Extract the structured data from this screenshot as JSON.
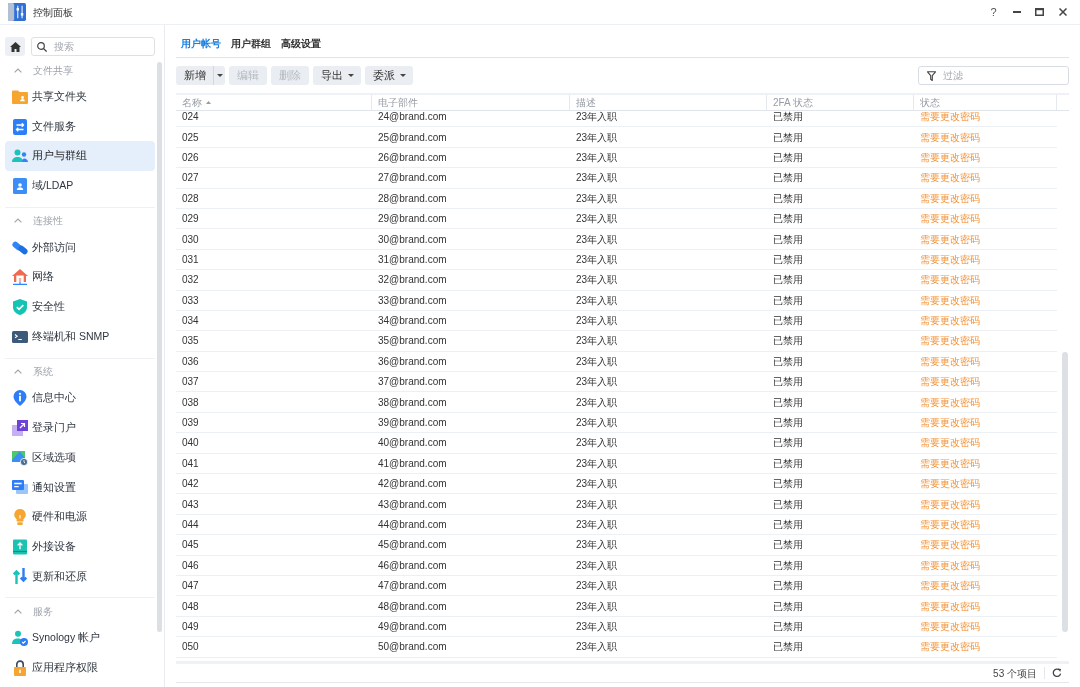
{
  "window": {
    "title": "控制面板",
    "help": "?"
  },
  "sidebar": {
    "search": {
      "placeholder": "搜索"
    },
    "sections": [
      {
        "title": "文件共享",
        "expanded": true,
        "items": [
          {
            "label": "共享文件夹",
            "selected": false
          },
          {
            "label": "文件服务",
            "selected": false
          },
          {
            "label": "用户与群组",
            "selected": true
          },
          {
            "label": "域/LDAP",
            "selected": false
          }
        ]
      },
      {
        "title": "连接性",
        "expanded": true,
        "items": [
          {
            "label": "外部访问",
            "selected": false
          },
          {
            "label": "网络",
            "selected": false
          },
          {
            "label": "安全性",
            "selected": false
          },
          {
            "label": "终端机和 SNMP",
            "selected": false
          }
        ]
      },
      {
        "title": "系统",
        "expanded": true,
        "items": [
          {
            "label": "信息中心",
            "selected": false
          },
          {
            "label": "登录门户",
            "selected": false
          },
          {
            "label": "区域选项",
            "selected": false
          },
          {
            "label": "通知设置",
            "selected": false
          },
          {
            "label": "硬件和电源",
            "selected": false
          },
          {
            "label": "外接设备",
            "selected": false
          },
          {
            "label": "更新和还原",
            "selected": false
          }
        ]
      },
      {
        "title": "服务",
        "expanded": true,
        "items": [
          {
            "label": "Synology 帐户",
            "selected": false
          },
          {
            "label": "应用程序权限",
            "selected": false
          }
        ]
      }
    ]
  },
  "tabs": [
    {
      "label": "用户帐号",
      "selected": true
    },
    {
      "label": "用户群组",
      "selected": false
    },
    {
      "label": "高级设置",
      "selected": false
    }
  ],
  "toolbar": {
    "buttons": [
      {
        "label": "新增",
        "kind": "split",
        "disabled": false
      },
      {
        "label": "编辑",
        "kind": "plain",
        "disabled": true
      },
      {
        "label": "删除",
        "kind": "plain",
        "disabled": true
      },
      {
        "label": "导出",
        "kind": "menu",
        "disabled": false
      },
      {
        "label": "委派",
        "kind": "menu",
        "disabled": false
      }
    ],
    "filter": {
      "placeholder": "过滤"
    }
  },
  "table": {
    "columns": [
      {
        "label": "名称",
        "sorted": true
      },
      {
        "label": "电子部件",
        "sorted": false
      },
      {
        "label": "描述",
        "sorted": false
      },
      {
        "label": "2FA 状态",
        "sorted": false
      },
      {
        "label": "状态",
        "sorted": false
      }
    ],
    "rows": [
      {
        "name": "024",
        "email": "24@brand.com",
        "description": "23年入职",
        "twofa": "已禁用",
        "status": "需要更改密码"
      },
      {
        "name": "025",
        "email": "25@brand.com",
        "description": "23年入职",
        "twofa": "已禁用",
        "status": "需要更改密码"
      },
      {
        "name": "026",
        "email": "26@brand.com",
        "description": "23年入职",
        "twofa": "已禁用",
        "status": "需要更改密码"
      },
      {
        "name": "027",
        "email": "27@brand.com",
        "description": "23年入职",
        "twofa": "已禁用",
        "status": "需要更改密码"
      },
      {
        "name": "028",
        "email": "28@brand.com",
        "description": "23年入职",
        "twofa": "已禁用",
        "status": "需要更改密码"
      },
      {
        "name": "029",
        "email": "29@brand.com",
        "description": "23年入职",
        "twofa": "已禁用",
        "status": "需要更改密码"
      },
      {
        "name": "030",
        "email": "30@brand.com",
        "description": "23年入职",
        "twofa": "已禁用",
        "status": "需要更改密码"
      },
      {
        "name": "031",
        "email": "31@brand.com",
        "description": "23年入职",
        "twofa": "已禁用",
        "status": "需要更改密码"
      },
      {
        "name": "032",
        "email": "32@brand.com",
        "description": "23年入职",
        "twofa": "已禁用",
        "status": "需要更改密码"
      },
      {
        "name": "033",
        "email": "33@brand.com",
        "description": "23年入职",
        "twofa": "已禁用",
        "status": "需要更改密码"
      },
      {
        "name": "034",
        "email": "34@brand.com",
        "description": "23年入职",
        "twofa": "已禁用",
        "status": "需要更改密码"
      },
      {
        "name": "035",
        "email": "35@brand.com",
        "description": "23年入职",
        "twofa": "已禁用",
        "status": "需要更改密码"
      },
      {
        "name": "036",
        "email": "36@brand.com",
        "description": "23年入职",
        "twofa": "已禁用",
        "status": "需要更改密码"
      },
      {
        "name": "037",
        "email": "37@brand.com",
        "description": "23年入职",
        "twofa": "已禁用",
        "status": "需要更改密码"
      },
      {
        "name": "038",
        "email": "38@brand.com",
        "description": "23年入职",
        "twofa": "已禁用",
        "status": "需要更改密码"
      },
      {
        "name": "039",
        "email": "39@brand.com",
        "description": "23年入职",
        "twofa": "已禁用",
        "status": "需要更改密码"
      },
      {
        "name": "040",
        "email": "40@brand.com",
        "description": "23年入职",
        "twofa": "已禁用",
        "status": "需要更改密码"
      },
      {
        "name": "041",
        "email": "41@brand.com",
        "description": "23年入职",
        "twofa": "已禁用",
        "status": "需要更改密码"
      },
      {
        "name": "042",
        "email": "42@brand.com",
        "description": "23年入职",
        "twofa": "已禁用",
        "status": "需要更改密码"
      },
      {
        "name": "043",
        "email": "43@brand.com",
        "description": "23年入职",
        "twofa": "已禁用",
        "status": "需要更改密码"
      },
      {
        "name": "044",
        "email": "44@brand.com",
        "description": "23年入职",
        "twofa": "已禁用",
        "status": "需要更改密码"
      },
      {
        "name": "045",
        "email": "45@brand.com",
        "description": "23年入职",
        "twofa": "已禁用",
        "status": "需要更改密码"
      },
      {
        "name": "046",
        "email": "46@brand.com",
        "description": "23年入职",
        "twofa": "已禁用",
        "status": "需要更改密码"
      },
      {
        "name": "047",
        "email": "47@brand.com",
        "description": "23年入职",
        "twofa": "已禁用",
        "status": "需要更改密码"
      },
      {
        "name": "048",
        "email": "48@brand.com",
        "description": "23年入职",
        "twofa": "已禁用",
        "status": "需要更改密码"
      },
      {
        "name": "049",
        "email": "49@brand.com",
        "description": "23年入职",
        "twofa": "已禁用",
        "status": "需要更改密码"
      },
      {
        "name": "050",
        "email": "50@brand.com",
        "description": "23年入职",
        "twofa": "已禁用",
        "status": "需要更改密码"
      }
    ]
  },
  "footer": {
    "count": "53 个项目"
  }
}
